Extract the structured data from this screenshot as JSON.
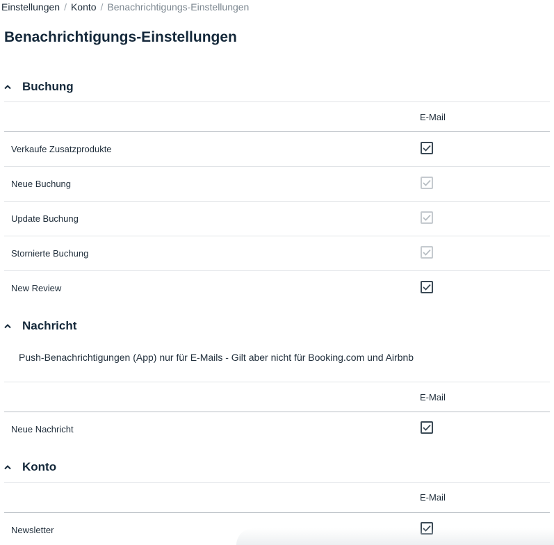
{
  "breadcrumb": {
    "items": [
      "Einstellungen",
      "Konto",
      "Benachrichtigungs-Einstellungen"
    ],
    "separator": "/"
  },
  "page": {
    "title": "Benachrichtigungs-Einstellungen"
  },
  "sections": [
    {
      "title": "Buchung",
      "column": "E-Mail",
      "rows": [
        {
          "label": "Verkaufe Zusatzprodukte",
          "checked": true,
          "disabled": false
        },
        {
          "label": "Neue Buchung",
          "checked": true,
          "disabled": true
        },
        {
          "label": "Update Buchung",
          "checked": true,
          "disabled": true
        },
        {
          "label": "Stornierte Buchung",
          "checked": true,
          "disabled": true
        },
        {
          "label": "New Review",
          "checked": true,
          "disabled": false
        }
      ]
    },
    {
      "title": "Nachricht",
      "info": "Push-Benachrichtigungen (App) nur für E-Mails - Gilt aber nicht für Booking.com und Airbnb",
      "column": "E-Mail",
      "rows": [
        {
          "label": "Neue Nachricht",
          "checked": true,
          "disabled": false
        }
      ]
    },
    {
      "title": "Konto",
      "column": "E-Mail",
      "rows": [
        {
          "label": "Newsletter",
          "checked": true,
          "disabled": false
        }
      ]
    }
  ],
  "icons": {
    "collapse": "chevron-up-icon",
    "check": "check-icon"
  },
  "colors": {
    "text": "#1f2d3a",
    "heading": "#14283a",
    "checkbox_border": "#3b4a56",
    "checkbox_disabled": "#c5cacf"
  }
}
